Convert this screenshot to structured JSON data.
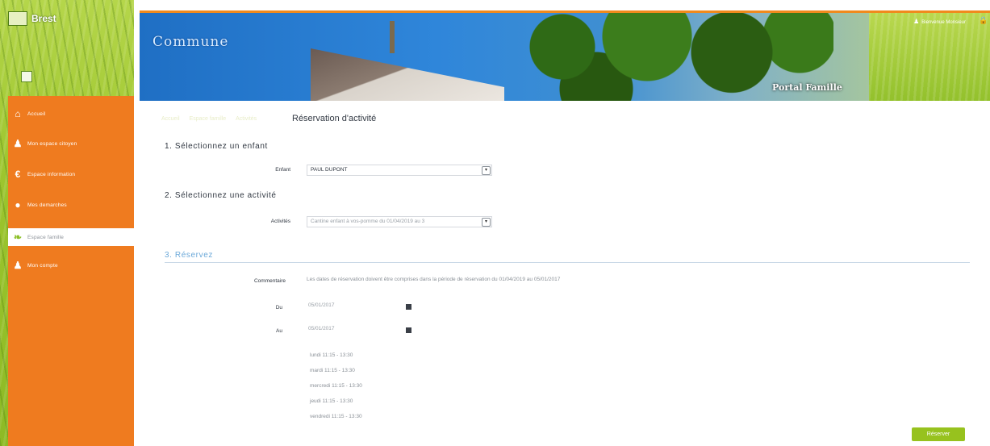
{
  "app": {
    "logo_text": "Brest"
  },
  "header": {
    "title": "Commune",
    "portal_label": "Portal Famille",
    "user_link": "Bienvenue Monsieur"
  },
  "sidebar": {
    "items": [
      {
        "label": "Accueil",
        "icon": "home-icon"
      },
      {
        "label": "Mon espace citoyen",
        "icon": "person-icon"
      },
      {
        "label": "Espace information",
        "icon": "info-icon"
      },
      {
        "label": "Mes demarches",
        "icon": "chat-icon"
      },
      {
        "label": "Espace famille",
        "icon": "leaf-icon"
      },
      {
        "label": "Mon compte",
        "icon": "person-icon"
      }
    ],
    "active_index": 4
  },
  "breadcrumb": [
    "Accueil",
    "Espace famille",
    "Activités"
  ],
  "page_title": "Réservation d'activité",
  "step1": {
    "title": "1. Sélectionnez un enfant",
    "label": "Enfant",
    "value": "PAUL DUPONT"
  },
  "step2": {
    "title": "2. Sélectionnez une activité",
    "label": "Activités",
    "value": "Cantine enfant à vos-pomme du 01/04/2019 au 3"
  },
  "step3": {
    "title": "3. Réservez",
    "comment_label": "Commentaire",
    "comment": "Les dates de réservation doivent être comprises dans la période de réservation du 01/04/2019 au 05/01/2017",
    "from_label": "Du",
    "from_value": "05/01/2017",
    "to_label": "Au",
    "to_value": "05/01/2017",
    "slots": [
      "lundi 11:15 - 13:30",
      "mardi 11:15 - 13:30",
      "mercredi 11:15 - 13:30",
      "jeudi 11:15 - 13:30",
      "vendredi 11:15 - 13:30"
    ]
  },
  "actions": {
    "submit_label": "Réserver"
  }
}
